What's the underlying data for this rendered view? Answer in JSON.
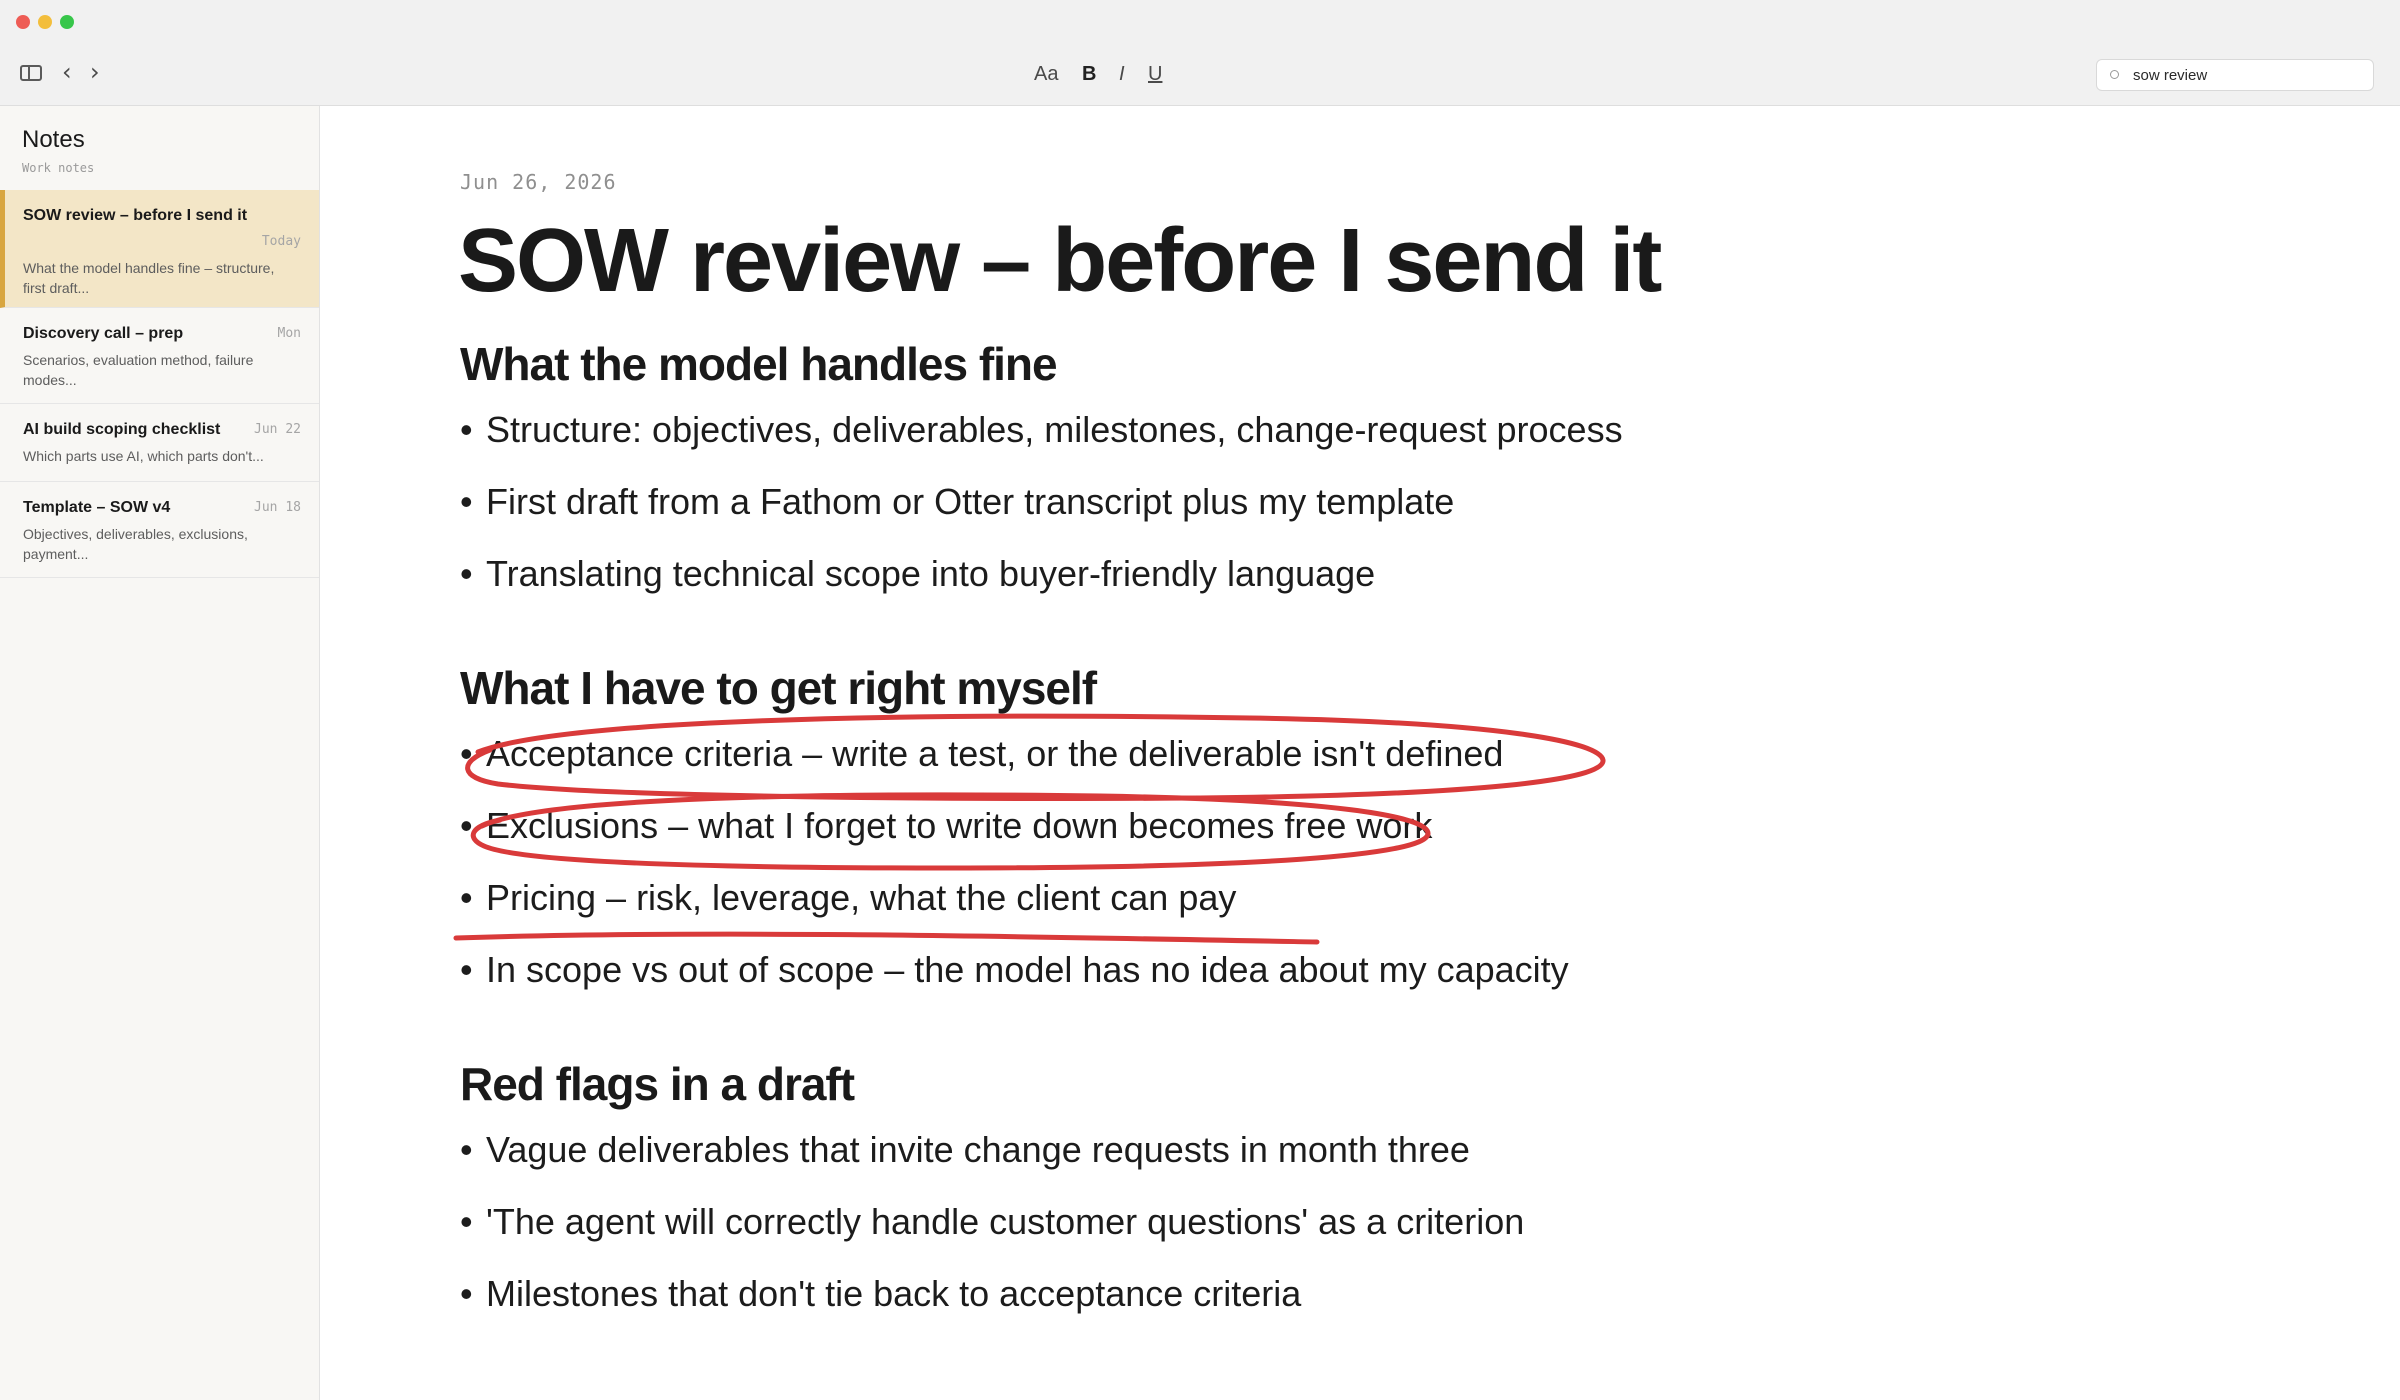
{
  "toolbar": {
    "format_font": "Aa",
    "format_bold": "B",
    "format_italic": "I",
    "format_underline": "U",
    "back": "‹",
    "forward": "›",
    "search_value": "sow review"
  },
  "sidebar": {
    "title": "Notes",
    "subtitle": "Work notes",
    "notes": [
      {
        "title": "SOW review – before I send it",
        "date": "Today",
        "snippet": "What the model handles fine – structure, first draft..."
      },
      {
        "title": "Discovery call – prep",
        "date": "Mon",
        "snippet": "Scenarios, evaluation method, failure modes..."
      },
      {
        "title": "AI build scoping checklist",
        "date": "Jun 22",
        "snippet": "Which parts use AI, which parts don't..."
      },
      {
        "title": "Template – SOW v4",
        "date": "Jun 18",
        "snippet": "Objectives, deliverables, exclusions, payment..."
      }
    ]
  },
  "note": {
    "date": "Jun 26, 2026",
    "title": "SOW review – before I send it",
    "sections": [
      {
        "heading": "What the model handles fine",
        "bullets": [
          "Structure: objectives, deliverables, milestones, change-request process",
          "First draft from a Fathom or Otter transcript plus my template",
          "Translating technical scope into buyer-friendly language"
        ]
      },
      {
        "heading": "What I have to get right myself",
        "bullets": [
          "Acceptance criteria – write a test, or the deliverable isn't defined",
          "Exclusions – what I forget to write down becomes free work",
          "Pricing – risk, leverage, what the client can pay",
          "In scope vs out of scope – the model has no idea about my capacity"
        ]
      },
      {
        "heading": "Red flags in a draft",
        "bullets": [
          "Vague deliverables that invite change requests in month three",
          "'The agent will correctly handle customer questions' as a criterion",
          "Milestones that don't tie back to acceptance criteria"
        ]
      }
    ]
  },
  "colors": {
    "active_note_bg": "#f3e6c7",
    "active_note_accent": "#d8a640",
    "annotation_red": "#d93a3a"
  }
}
